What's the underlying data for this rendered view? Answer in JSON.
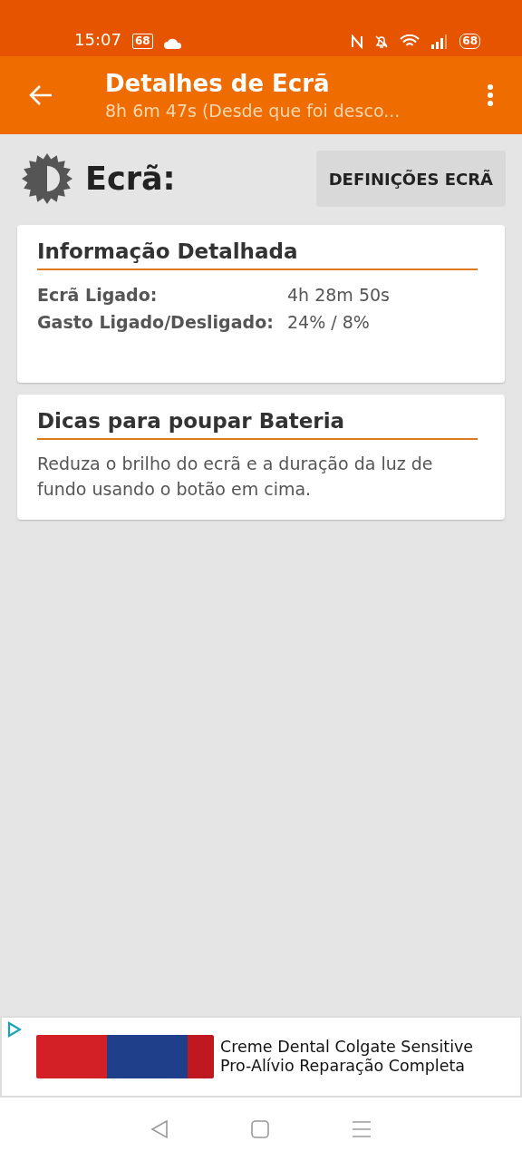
{
  "status_bar": {
    "time": "15:07",
    "notification_badge": "68",
    "battery": "68"
  },
  "toolbar": {
    "title": "Detalhes de Ecrã",
    "subtitle": "8h 6m 47s (Desde que foi desco..."
  },
  "header": {
    "title": "Ecrã:",
    "button": "DEFINIÇÕES ECRÃ"
  },
  "cards": [
    {
      "title": "Informação Detalhada",
      "kind": "table",
      "rows": [
        {
          "label": "Ecrã Ligado:",
          "value": "4h 28m 50s"
        },
        {
          "label": "Gasto Ligado/Desligado:",
          "value": "24% / 8%"
        }
      ]
    },
    {
      "title": "Dicas para poupar Bateria",
      "kind": "text",
      "text": "Reduza o brilho do ecrã e a duração da luz de fundo usando o botão em cima."
    }
  ],
  "ad": {
    "text": "Creme Dental Colgate Sensitive Pro-Alívio Reparação Completa"
  }
}
